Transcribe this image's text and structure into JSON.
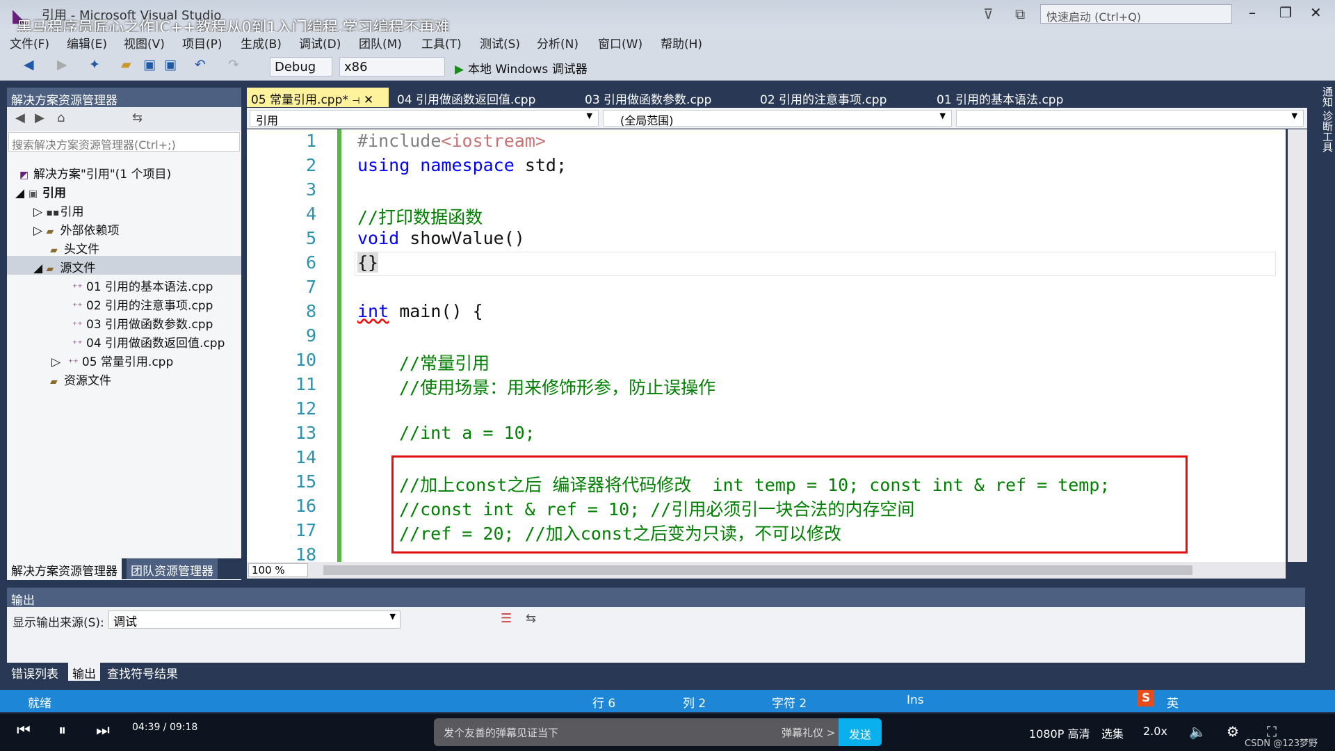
{
  "window": {
    "title": "引用 - Microsoft Visual Studio",
    "video_overlay": "黑马程序员匠心之作|C++教程从0到1入门编程,学习编程不再难",
    "quick_launch": "快速启动 (Ctrl+Q)"
  },
  "menu": [
    "文件(F)",
    "编辑(E)",
    "视图(V)",
    "项目(P)",
    "生成(B)",
    "调试(D)",
    "团队(M)",
    "工具(T)",
    "测试(S)",
    "分析(N)",
    "窗口(W)",
    "帮助(H)"
  ],
  "toolbar": {
    "config": "Debug",
    "platform": "x86",
    "run": "本地 Windows 调试器"
  },
  "solution_explorer": {
    "title": "解决方案资源管理器",
    "search_placeholder": "搜索解决方案资源管理器(Ctrl+;)",
    "tree": [
      {
        "label": "解决方案\"引用\"(1 个项目)"
      },
      {
        "label": "引用"
      },
      {
        "label": "引用"
      },
      {
        "label": "外部依赖项"
      },
      {
        "label": "头文件"
      },
      {
        "label": "源文件"
      },
      {
        "label": "01 引用的基本语法.cpp"
      },
      {
        "label": "02 引用的注意事项.cpp"
      },
      {
        "label": "03 引用做函数参数.cpp"
      },
      {
        "label": "04 引用做函数返回值.cpp"
      },
      {
        "label": "05 常量引用.cpp"
      },
      {
        "label": "资源文件"
      }
    ],
    "tabs": [
      "解决方案资源管理器",
      "团队资源管理器"
    ]
  },
  "editor": {
    "tabs": [
      "05 常量引用.cpp*",
      "04 引用做函数返回值.cpp",
      "03 引用做函数参数.cpp",
      "02 引用的注意事项.cpp",
      "01 引用的基本语法.cpp"
    ],
    "nav_project": "引用",
    "nav_scope": "(全局范围)",
    "zoom": "100 %",
    "lines": [
      "1",
      "2",
      "3",
      "4",
      "5",
      "6",
      "7",
      "8",
      "9",
      "10",
      "11",
      "12",
      "13",
      "14",
      "15",
      "16",
      "17",
      "18"
    ],
    "code": {
      "l1a": "#include",
      "l1b": "<iostream>",
      "l2a": "using namespace",
      "l2b": " std;",
      "l4": "//打印数据函数",
      "l5a": "void",
      "l5b": " showValue()",
      "l6": "{}",
      "l8a": "int",
      "l8b": " main() {",
      "l10": "//常量引用",
      "l11": "//使用场景：用来修饰形参，防止误操作",
      "l13": "//int a = 10;",
      "l15": "//加上const之后 编译器将代码修改  int temp = 10; const int & ref = temp;",
      "l16": "//const int & ref = 10; //引用必须引一块合法的内存空间",
      "l17": "//ref = 20; //加入const之后变为只读，不可以修改"
    }
  },
  "output": {
    "title": "输出",
    "source_label": "显示输出来源(S):",
    "source_value": "调试",
    "tabs": [
      "错误列表",
      "输出",
      "查找符号结果"
    ]
  },
  "right_strip": "通知  诊断工具",
  "status": {
    "ready": "就绪",
    "line": "行 6",
    "col": "列 2",
    "char": "字符 2",
    "mode": "Ins"
  },
  "player": {
    "time": "04:39 / 09:18",
    "danmu_placeholder": "发个友善的弹幕见证当下",
    "etiquette": "弹幕礼仪 >",
    "send": "发送",
    "quality": "1080P 高清",
    "episodes": "选集",
    "speed": "2.0x",
    "ime": "英",
    "watermark": "CSDN @123梦野"
  }
}
